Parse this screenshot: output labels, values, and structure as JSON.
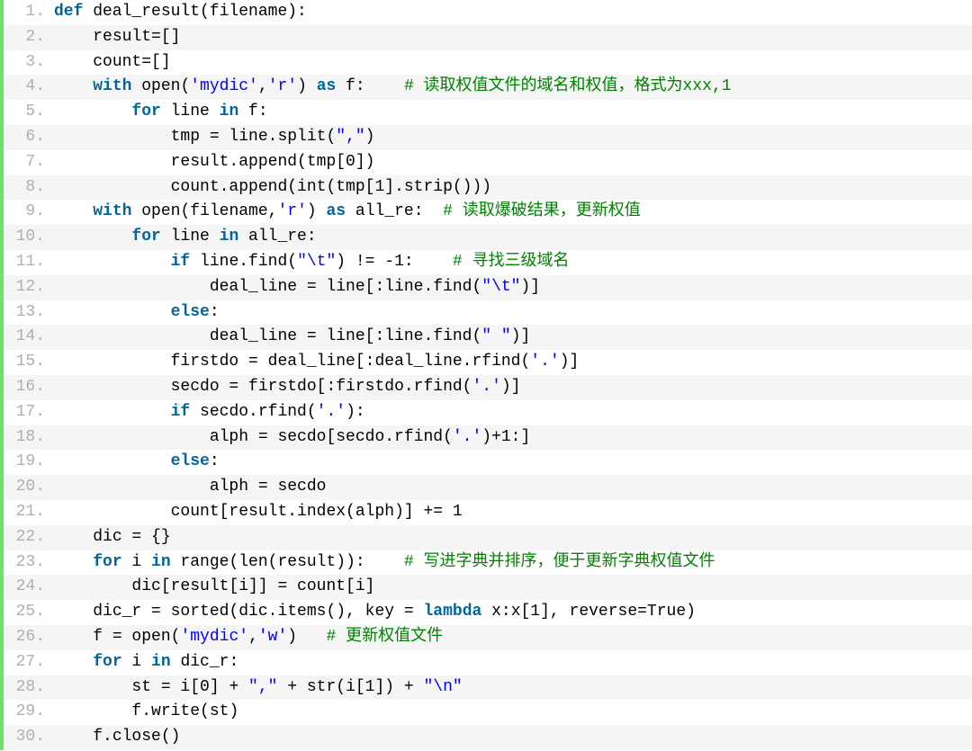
{
  "lines": [
    {
      "n": "1.",
      "indent": 0,
      "tokens": [
        {
          "type": "kw",
          "t": "def"
        },
        {
          "type": "txt",
          "t": " deal_result(filename):"
        }
      ]
    },
    {
      "n": "2.",
      "indent": 1,
      "tokens": [
        {
          "type": "txt",
          "t": "result=[]"
        }
      ]
    },
    {
      "n": "3.",
      "indent": 1,
      "tokens": [
        {
          "type": "txt",
          "t": "count=[]"
        }
      ]
    },
    {
      "n": "4.",
      "indent": 1,
      "tokens": [
        {
          "type": "kw",
          "t": "with"
        },
        {
          "type": "txt",
          "t": " open("
        },
        {
          "type": "str",
          "t": "'mydic'"
        },
        {
          "type": "txt",
          "t": ","
        },
        {
          "type": "str",
          "t": "'r'"
        },
        {
          "type": "txt",
          "t": ") "
        },
        {
          "type": "kw",
          "t": "as"
        },
        {
          "type": "txt",
          "t": " f:    "
        },
        {
          "type": "cmt",
          "t": "# 读取权值文件的域名和权值，格式为xxx,1"
        }
      ]
    },
    {
      "n": "5.",
      "indent": 2,
      "tokens": [
        {
          "type": "kw",
          "t": "for"
        },
        {
          "type": "txt",
          "t": " line "
        },
        {
          "type": "kw",
          "t": "in"
        },
        {
          "type": "txt",
          "t": " f:"
        }
      ]
    },
    {
      "n": "6.",
      "indent": 3,
      "tokens": [
        {
          "type": "txt",
          "t": "tmp = line.split("
        },
        {
          "type": "str",
          "t": "\",\""
        },
        {
          "type": "txt",
          "t": ")"
        }
      ]
    },
    {
      "n": "7.",
      "indent": 3,
      "tokens": [
        {
          "type": "txt",
          "t": "result.append(tmp[0])"
        }
      ]
    },
    {
      "n": "8.",
      "indent": 3,
      "tokens": [
        {
          "type": "txt",
          "t": "count.append(int(tmp[1].strip()))"
        }
      ]
    },
    {
      "n": "9.",
      "indent": 1,
      "tokens": [
        {
          "type": "kw",
          "t": "with"
        },
        {
          "type": "txt",
          "t": " open(filename,"
        },
        {
          "type": "str",
          "t": "'r'"
        },
        {
          "type": "txt",
          "t": ") "
        },
        {
          "type": "kw",
          "t": "as"
        },
        {
          "type": "txt",
          "t": " all_re:  "
        },
        {
          "type": "cmt",
          "t": "# 读取爆破结果，更新权值"
        }
      ]
    },
    {
      "n": "10.",
      "indent": 2,
      "tokens": [
        {
          "type": "kw",
          "t": "for"
        },
        {
          "type": "txt",
          "t": " line "
        },
        {
          "type": "kw",
          "t": "in"
        },
        {
          "type": "txt",
          "t": " all_re:"
        }
      ]
    },
    {
      "n": "11.",
      "indent": 3,
      "tokens": [
        {
          "type": "kw",
          "t": "if"
        },
        {
          "type": "txt",
          "t": " line.find("
        },
        {
          "type": "str",
          "t": "\"\\t\""
        },
        {
          "type": "txt",
          "t": ") != -1:    "
        },
        {
          "type": "cmt",
          "t": "# 寻找三级域名"
        }
      ]
    },
    {
      "n": "12.",
      "indent": 4,
      "tokens": [
        {
          "type": "txt",
          "t": "deal_line = line[:line.find("
        },
        {
          "type": "str",
          "t": "\"\\t\""
        },
        {
          "type": "txt",
          "t": ")]"
        }
      ]
    },
    {
      "n": "13.",
      "indent": 3,
      "tokens": [
        {
          "type": "kw",
          "t": "else"
        },
        {
          "type": "txt",
          "t": ":"
        }
      ]
    },
    {
      "n": "14.",
      "indent": 4,
      "tokens": [
        {
          "type": "txt",
          "t": "deal_line = line[:line.find("
        },
        {
          "type": "str",
          "t": "\" \""
        },
        {
          "type": "txt",
          "t": ")]"
        }
      ]
    },
    {
      "n": "15.",
      "indent": 3,
      "tokens": [
        {
          "type": "txt",
          "t": "firstdo = deal_line[:deal_line.rfind("
        },
        {
          "type": "str",
          "t": "'.'"
        },
        {
          "type": "txt",
          "t": ")]"
        }
      ]
    },
    {
      "n": "16.",
      "indent": 3,
      "tokens": [
        {
          "type": "txt",
          "t": "secdo = firstdo[:firstdo.rfind("
        },
        {
          "type": "str",
          "t": "'.'"
        },
        {
          "type": "txt",
          "t": ")]"
        }
      ]
    },
    {
      "n": "17.",
      "indent": 3,
      "tokens": [
        {
          "type": "kw",
          "t": "if"
        },
        {
          "type": "txt",
          "t": " secdo.rfind("
        },
        {
          "type": "str",
          "t": "'.'"
        },
        {
          "type": "txt",
          "t": "):"
        }
      ]
    },
    {
      "n": "18.",
      "indent": 4,
      "tokens": [
        {
          "type": "txt",
          "t": "alph = secdo[secdo.rfind("
        },
        {
          "type": "str",
          "t": "'.'"
        },
        {
          "type": "txt",
          "t": ")+1:]"
        }
      ]
    },
    {
      "n": "19.",
      "indent": 3,
      "tokens": [
        {
          "type": "kw",
          "t": "else"
        },
        {
          "type": "txt",
          "t": ":"
        }
      ]
    },
    {
      "n": "20.",
      "indent": 4,
      "tokens": [
        {
          "type": "txt",
          "t": "alph = secdo"
        }
      ]
    },
    {
      "n": "21.",
      "indent": 3,
      "tokens": [
        {
          "type": "txt",
          "t": "count[result.index(alph)] += 1"
        }
      ]
    },
    {
      "n": "22.",
      "indent": 1,
      "tokens": [
        {
          "type": "txt",
          "t": "dic = {}"
        }
      ]
    },
    {
      "n": "23.",
      "indent": 1,
      "tokens": [
        {
          "type": "kw",
          "t": "for"
        },
        {
          "type": "txt",
          "t": " i "
        },
        {
          "type": "kw",
          "t": "in"
        },
        {
          "type": "txt",
          "t": " range(len(result)):    "
        },
        {
          "type": "cmt",
          "t": "# 写进字典并排序，便于更新字典权值文件"
        }
      ]
    },
    {
      "n": "24.",
      "indent": 2,
      "tokens": [
        {
          "type": "txt",
          "t": "dic[result[i]] = count[i]"
        }
      ]
    },
    {
      "n": "25.",
      "indent": 1,
      "tokens": [
        {
          "type": "txt",
          "t": "dic_r = sorted(dic.items(), key = "
        },
        {
          "type": "kw",
          "t": "lambda"
        },
        {
          "type": "txt",
          "t": " x:x[1], reverse=True)"
        }
      ]
    },
    {
      "n": "26.",
      "indent": 1,
      "tokens": [
        {
          "type": "txt",
          "t": "f = open("
        },
        {
          "type": "str",
          "t": "'mydic'"
        },
        {
          "type": "txt",
          "t": ","
        },
        {
          "type": "str",
          "t": "'w'"
        },
        {
          "type": "txt",
          "t": ")   "
        },
        {
          "type": "cmt",
          "t": "# 更新权值文件"
        }
      ]
    },
    {
      "n": "27.",
      "indent": 1,
      "tokens": [
        {
          "type": "kw",
          "t": "for"
        },
        {
          "type": "txt",
          "t": " i "
        },
        {
          "type": "kw",
          "t": "in"
        },
        {
          "type": "txt",
          "t": " dic_r:"
        }
      ]
    },
    {
      "n": "28.",
      "indent": 2,
      "tokens": [
        {
          "type": "txt",
          "t": "st = i[0] + "
        },
        {
          "type": "str",
          "t": "\",\""
        },
        {
          "type": "txt",
          "t": " + str(i[1]) + "
        },
        {
          "type": "str",
          "t": "\"\\n\""
        }
      ]
    },
    {
      "n": "29.",
      "indent": 2,
      "tokens": [
        {
          "type": "txt",
          "t": "f.write(st)"
        }
      ]
    },
    {
      "n": "30.",
      "indent": 1,
      "tokens": [
        {
          "type": "txt",
          "t": "f.close()"
        }
      ]
    }
  ]
}
